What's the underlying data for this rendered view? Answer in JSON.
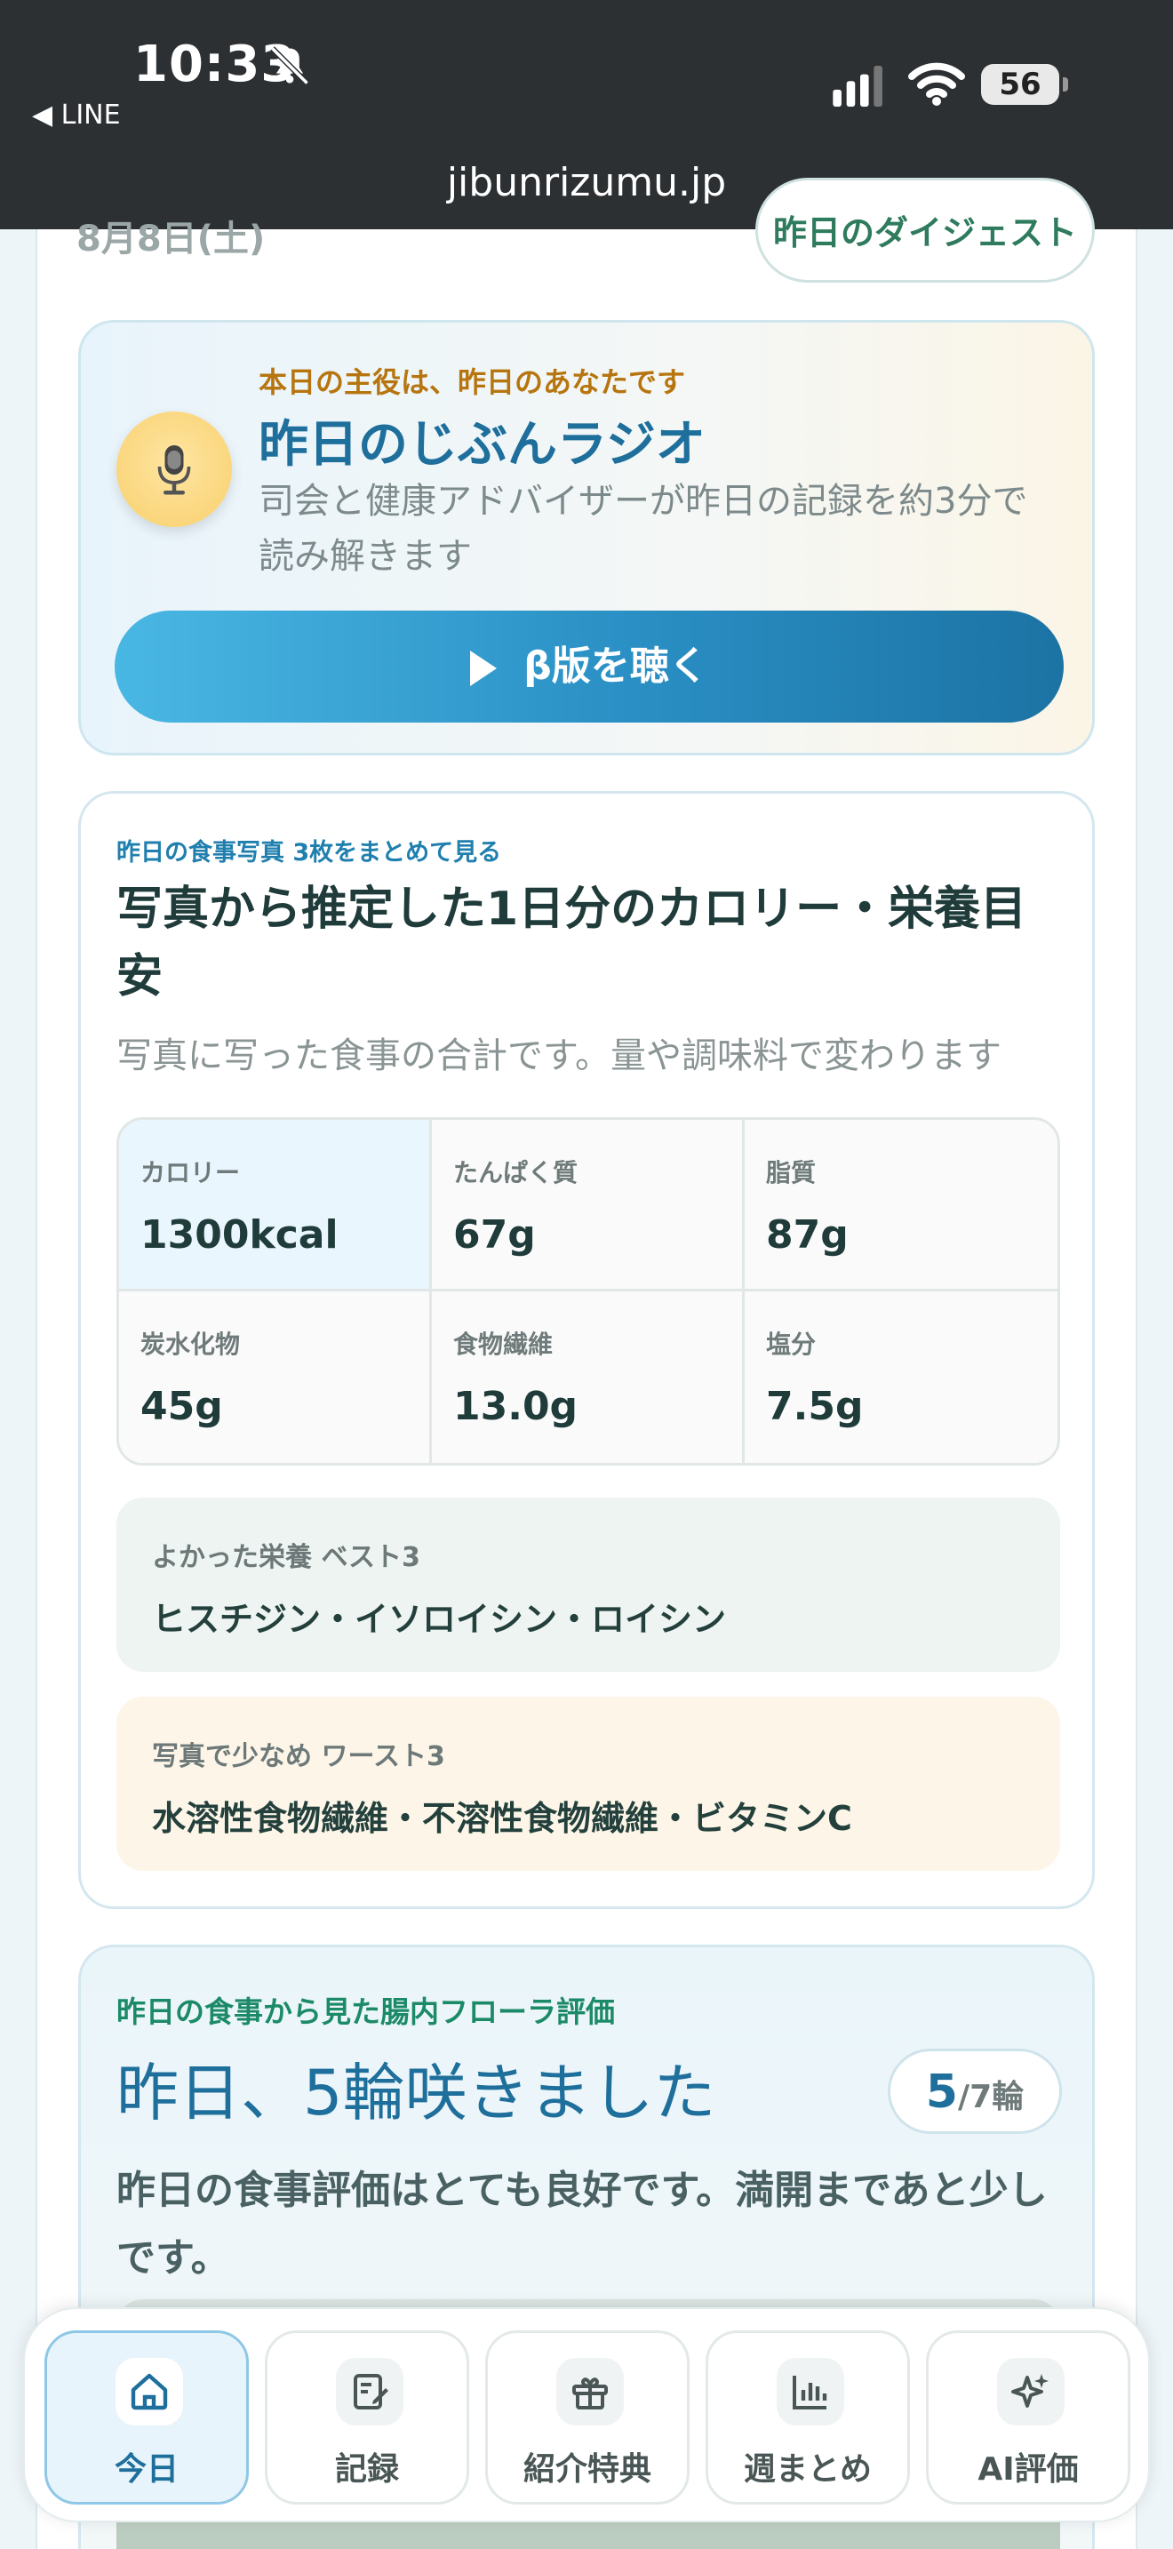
{
  "status_bar": {
    "time": "10:33",
    "back_label": "◀ LINE",
    "battery": "56",
    "url": "jibunrizumu.jp"
  },
  "header": {
    "date": "8月8日(土)",
    "digest_button": "昨日のダイジェスト"
  },
  "radio": {
    "eyebrow": "本日の主役は、昨日のあなたです",
    "title": "昨日のじぶんラジオ",
    "description": "司会と健康アドバイザーが昨日の記録を約3分で読み解きます",
    "button_label": "β版を聴く"
  },
  "nutrition": {
    "eyebrow": "昨日の食事写真 3枚をまとめて見る",
    "title": "写真から推定した1日分のカロリー・栄養目安",
    "subtitle": "写真に写った食事の合計です。量や調味料で変わります",
    "cells": [
      {
        "label": "カロリー",
        "value": "1300kcal"
      },
      {
        "label": "たんぱく質",
        "value": "67g"
      },
      {
        "label": "脂質",
        "value": "87g"
      },
      {
        "label": "炭水化物",
        "value": "45g"
      },
      {
        "label": "食物繊維",
        "value": "13.0g"
      },
      {
        "label": "塩分",
        "value": "7.5g"
      }
    ],
    "best": {
      "label": "よかった栄養 ベスト3",
      "value": "ヒスチジン・イソロイシン・ロイシン"
    },
    "worst": {
      "label": "写真で少なめ ワースト3",
      "value": "水溶性食物繊維・不溶性食物繊維・ビタミンC"
    }
  },
  "flora": {
    "eyebrow": "昨日の食事から見た腸内フローラ評価",
    "title": "昨日、5輪咲きました",
    "badge_num": "5",
    "badge_den": "/7輪",
    "description": "昨日の食事評価はとても良好です。満開まであと少しです。"
  },
  "tabs": [
    {
      "label": "今日",
      "icon": "home-icon"
    },
    {
      "label": "記録",
      "icon": "edit-note-icon"
    },
    {
      "label": "紹介特典",
      "icon": "gift-icon"
    },
    {
      "label": "週まとめ",
      "icon": "bar-chart-icon"
    },
    {
      "label": "AI評価",
      "icon": "sparkles-icon"
    }
  ],
  "colors": {
    "accent_blue": "#1f6f9c",
    "accent_green": "#1c8a67",
    "accent_amber": "#b7750f"
  }
}
